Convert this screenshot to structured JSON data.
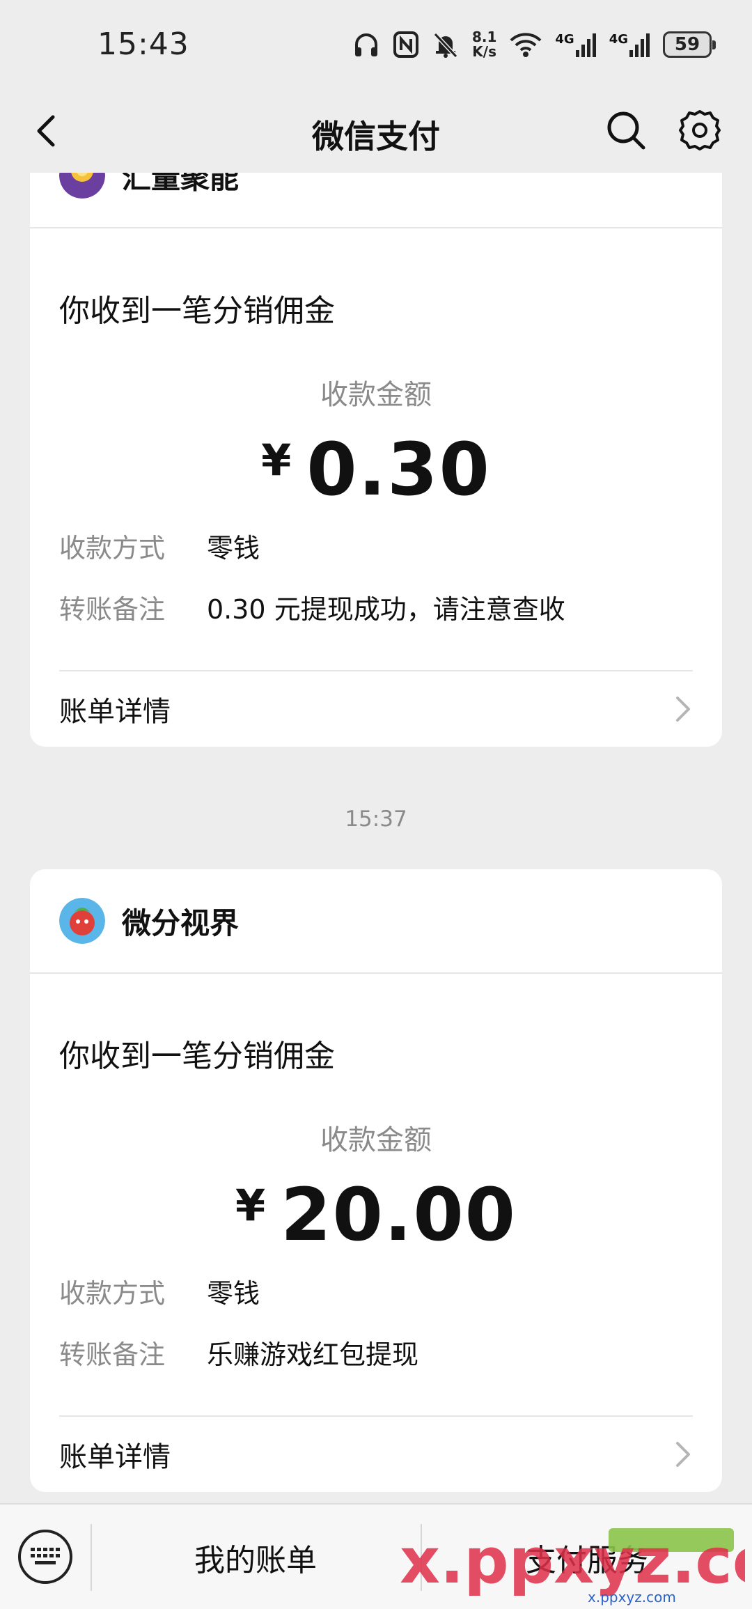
{
  "status": {
    "time": "15:43",
    "net_speed_value": "8.1",
    "net_speed_unit": "K/s",
    "sim1": "4G",
    "sim2": "4G",
    "battery": "59"
  },
  "nav": {
    "title": "微信支付"
  },
  "cards": [
    {
      "merchant": "汇量聚能",
      "title": "你收到一笔分销佣金",
      "amount_label": "收款金额",
      "currency": "¥",
      "amount": "0.30",
      "method_label": "收款方式",
      "method_value": "零钱",
      "note_label": "转账备注",
      "note_value": "0.30 元提现成功，请注意查收",
      "detail_label": "账单详情"
    },
    {
      "merchant": "微分视界",
      "title": "你收到一笔分销佣金",
      "amount_label": "收款金额",
      "currency": "¥",
      "amount": "20.00",
      "method_label": "收款方式",
      "method_value": "零钱",
      "note_label": "转账备注",
      "note_value": "乐赚游戏红包提现",
      "detail_label": "账单详情"
    }
  ],
  "timestamp": "15:37",
  "bottom": {
    "menu_1": "我的账单",
    "menu_2": "支付服务",
    "watermark": "x.ppxyz.com",
    "watermark_small": "x.ppxyz.com"
  },
  "colors": {
    "background": "#ededed",
    "card": "#ffffff",
    "secondary_text": "#8a8a8a",
    "watermark_red": "#e0304a",
    "watermark_blue": "#2a63c9"
  }
}
